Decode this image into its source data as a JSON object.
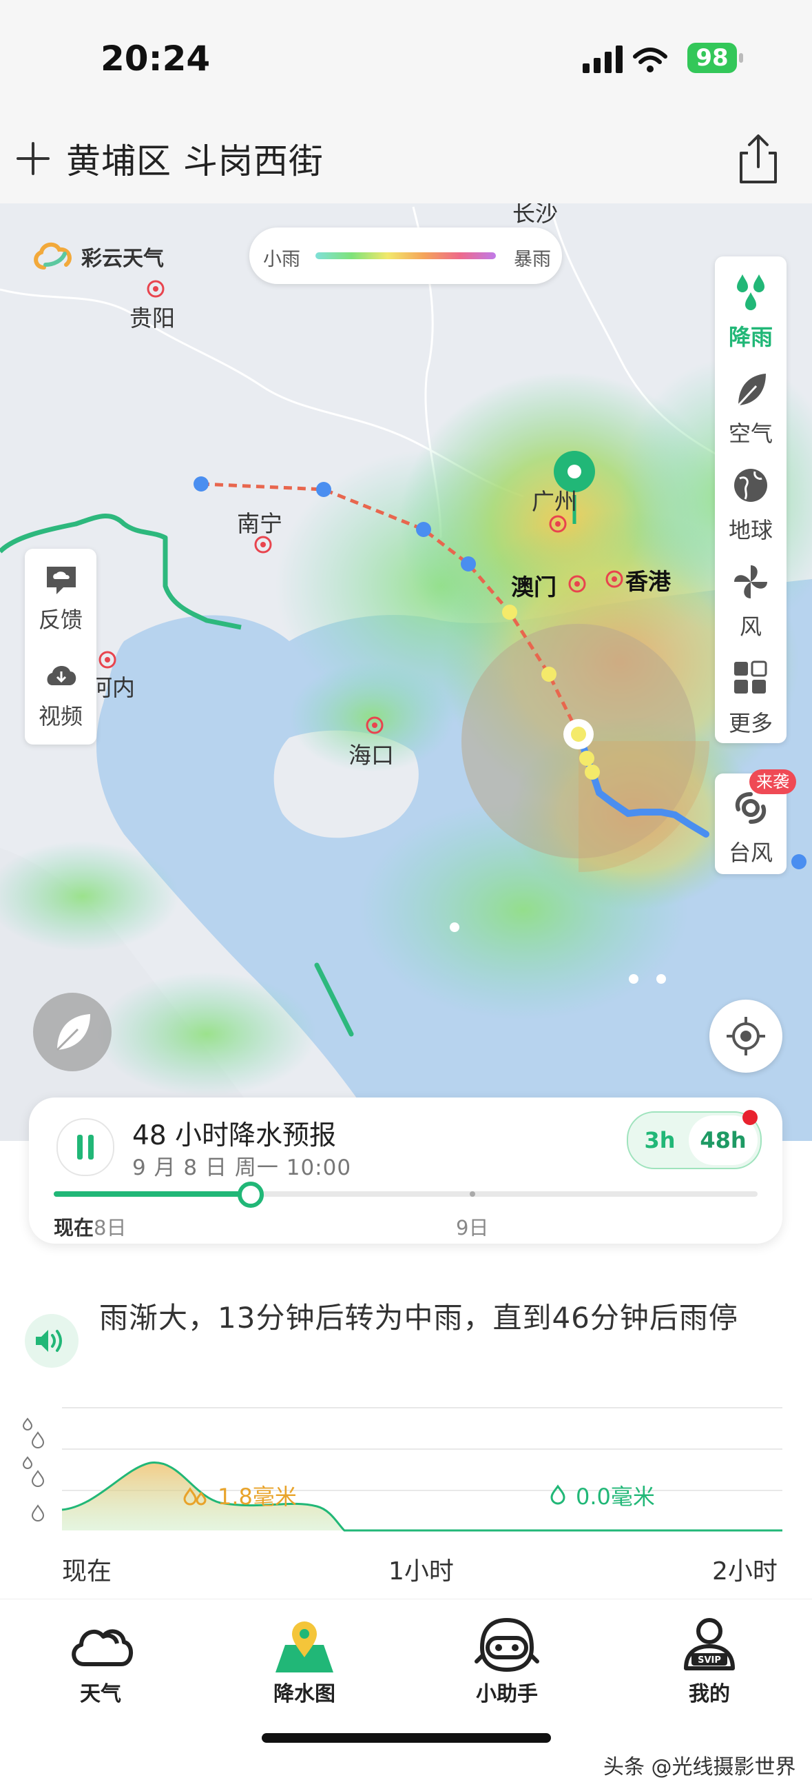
{
  "status_bar": {
    "time": "20:24",
    "battery": "98"
  },
  "header": {
    "location": "黄埔区 斗岗西街",
    "add_icon": "plus-icon",
    "share_icon": "share-icon"
  },
  "map": {
    "brand": "彩云天气",
    "legend": {
      "low": "小雨",
      "high": "暴雨"
    },
    "cities": {
      "changsha": "长沙",
      "guiyang": "贵阳",
      "nanning": "南宁",
      "guangzhou": "广州",
      "macau": "澳门",
      "hongkong": "香港",
      "hanoi": "河内",
      "haikou": "海口"
    },
    "left_panel": [
      {
        "icon": "feedback-icon",
        "label": "反馈"
      },
      {
        "icon": "video-icon",
        "label": "视频"
      }
    ],
    "right_panel": [
      {
        "icon": "rain-icon",
        "label": "降雨",
        "active": true
      },
      {
        "icon": "leaf-icon",
        "label": "空气"
      },
      {
        "icon": "globe-icon",
        "label": "地球"
      },
      {
        "icon": "wind-icon",
        "label": "风"
      },
      {
        "icon": "grid-icon",
        "label": "更多"
      }
    ],
    "typhoon": {
      "label": "台风",
      "badge": "来袭"
    }
  },
  "timeline": {
    "title": "48 小时降水预报",
    "date": "9 月 8 日 周一 10:00",
    "segments": [
      "3h",
      "48h"
    ],
    "selected_segment": "48h",
    "progress": 0.28,
    "now_label": "现在",
    "day_start": "8日",
    "day_next": "9日"
  },
  "summary": {
    "text": "雨渐大，13分钟后转为中雨，直到46分钟后雨停"
  },
  "precip_chart": {
    "peak_label": "1.8毫米",
    "end_label": "0.0毫米",
    "x_labels": [
      "现在",
      "1小时",
      "2小时"
    ]
  },
  "tabs": [
    {
      "icon": "cloud-icon",
      "label": "天气"
    },
    {
      "icon": "map-pin-icon",
      "label": "降水图",
      "active": true
    },
    {
      "icon": "assistant-icon",
      "label": "小助手"
    },
    {
      "icon": "profile-icon",
      "label": "我的"
    }
  ],
  "watermark": "头条 @光线摄影世界"
}
